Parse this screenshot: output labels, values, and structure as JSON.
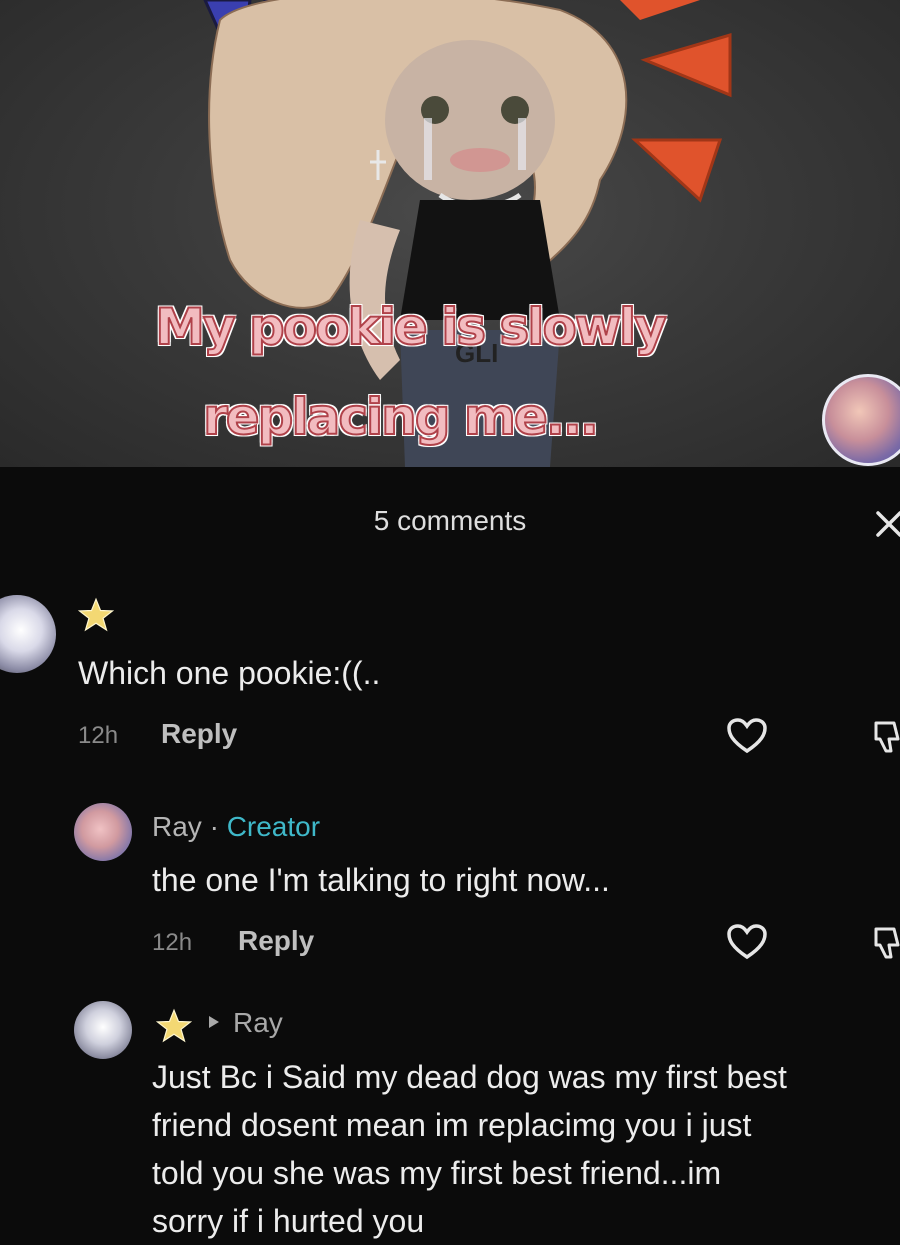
{
  "video": {
    "caption_line1": "My pookie is slowly",
    "caption_line2": "replacing me...",
    "shirt_text": "GLI"
  },
  "comments_header": {
    "count_label": "5 comments"
  },
  "comments": [
    {
      "author": "",
      "text": "Which one pookie:((..",
      "time": "12h",
      "reply_label": "Reply"
    },
    {
      "author": "Ray",
      "separator": " · ",
      "badge": "Creator",
      "text": "the one I'm talking to right now...",
      "time": "12h",
      "reply_label": "Reply"
    },
    {
      "author": "",
      "reply_to": "Ray",
      "text_lines": [
        "Just Bc i Said my dead dog was my first best",
        "friend dosent mean im replacimg you i just",
        "told you she was my first best friend...im",
        "sorry if i hurted you"
      ]
    }
  ],
  "colors": {
    "panel_bg": "#0b0b0b",
    "creator_badge": "#3fb8c9",
    "star": "#f3d873",
    "caption_fill": "#f2bcc0",
    "caption_outline": "#b0424a"
  },
  "icons": [
    "close-icon",
    "star-icon",
    "heart-icon",
    "dislike-icon",
    "reply-arrow-icon"
  ]
}
